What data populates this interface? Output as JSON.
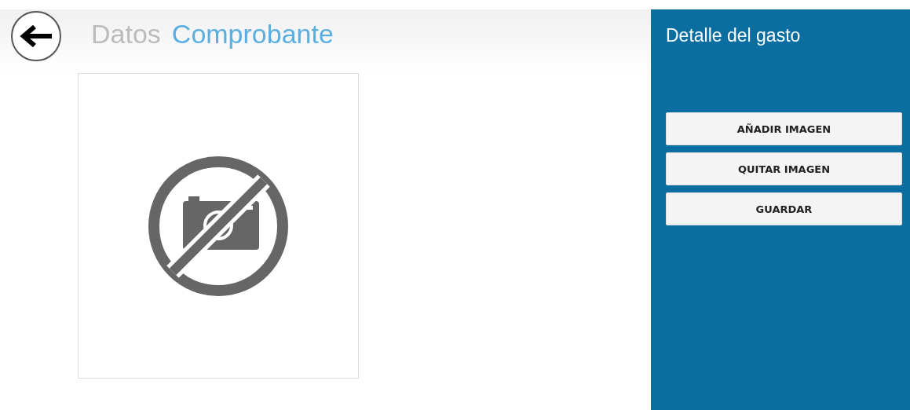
{
  "tabs": [
    {
      "label": "Datos",
      "selected": false
    },
    {
      "label": "Comprobante",
      "selected": true
    }
  ],
  "receipt": {
    "has_image": false
  },
  "panel": {
    "title": "Detalle del gasto",
    "buttons": [
      "AÑADIR IMAGEN",
      "QUITAR IMAGEN",
      "GUARDAR"
    ]
  }
}
